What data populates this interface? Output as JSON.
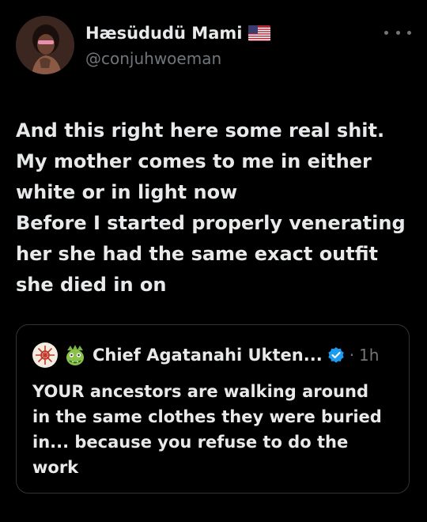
{
  "author": {
    "display_name": "Hæsüdudü Mami",
    "handle": "@conjuhwoeman",
    "flag_icon": "us-flag-icon",
    "avatar": "profile-photo"
  },
  "tweet": {
    "lines": [
      "And this right here some real shit.",
      "My mother comes to me in either",
      "white or in light now",
      "Before I started properly venerating",
      "her she had the same exact outfit",
      "she died in on"
    ]
  },
  "quoted": {
    "display_name": "Chief Agatanahi Ukten...",
    "separator": "·",
    "time": "1h",
    "lines": [
      "YOUR ancestors are walking around",
      "in the same clothes they were buried",
      "in... because you refuse to do the",
      "work"
    ]
  },
  "colors": {
    "background": "#000000",
    "text": "#e7e9ea",
    "muted": "#71767b",
    "verified": "#1d9bf0",
    "border": "#2f3336"
  }
}
